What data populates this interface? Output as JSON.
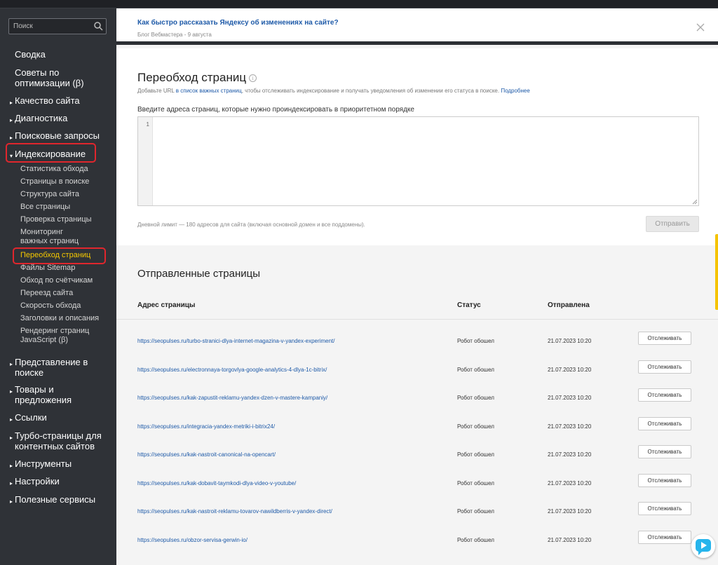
{
  "search": {
    "placeholder": "Поиск"
  },
  "sidebar": {
    "top_items": [
      "Сводка",
      "Советы по оптимизации (β)"
    ],
    "sections": [
      "Качество сайта",
      "Диагностика",
      "Поисковые запросы",
      "Индексирование",
      "Представление в поиске",
      "Товары и предложения",
      "Ссылки",
      "Турбо-страницы для контентных сайтов",
      "Инструменты",
      "Настройки",
      "Полезные сервисы"
    ],
    "indexing_items": [
      "Статистика обхода",
      "Страницы в поиске",
      "Структура сайта",
      "Все страницы",
      "Проверка страницы",
      "Мониторинг важных страниц",
      "Переобход страниц",
      "Файлы Sitemap",
      "Обход по счётчикам",
      "Переезд сайта",
      "Скорость обхода",
      "Заголовки и описания",
      "Рендеринг страниц JavaScript (β)"
    ]
  },
  "notice": {
    "title": "Как быстро рассказать Яндексу об изменениях на сайте?",
    "meta": "Блог Вебмастера - 9 августа"
  },
  "recrawl": {
    "title": "Переобход страниц",
    "desc_prefix": "Добавьте URL ",
    "desc_link": "в список важных страниц",
    "desc_middle": ", чтобы отслеживать индексирование и получать уведомления об изменении его статуса в поиске. ",
    "desc_more": "Подробнее",
    "field_label": "Введите адреса страниц, которые нужно проиндексировать в приоритетном порядке",
    "line_number": "1",
    "limit": "Дневной лимит — 180 адресов для сайта (включая основной домен и все поддомены).",
    "submit_label": "Отправить"
  },
  "sent": {
    "title": "Отправленные страницы",
    "columns": {
      "url": "Адрес страницы",
      "status": "Статус",
      "date": "Отправлена"
    },
    "track_label": "Отслеживать",
    "rows": [
      {
        "url": "https://seopulses.ru/turbo-stranici-dlya-internet-magazina-v-yandex-experiment/",
        "status": "Робот обошел",
        "date": "21.07.2023 10:20"
      },
      {
        "url": "https://seopulses.ru/electronnaya-torgovlya-google-analytics-4-dlya-1c-bitrix/",
        "status": "Робот обошел",
        "date": "21.07.2023 10:20"
      },
      {
        "url": "https://seopulses.ru/kak-zapustit-reklamu-yandex-dzen-v-mastere-kampaniy/",
        "status": "Робот обошел",
        "date": "21.07.2023 10:20"
      },
      {
        "url": "https://seopulses.ru/integracia-yandex-metriki-i-bitrix24/",
        "status": "Робот обошел",
        "date": "21.07.2023 10:20"
      },
      {
        "url": "https://seopulses.ru/kak-nastroit-canonical-na-opencart/",
        "status": "Робот обошел",
        "date": "21.07.2023 10:20"
      },
      {
        "url": "https://seopulses.ru/kak-dobavit-taymkodi-dlya-video-v-youtube/",
        "status": "Робот обошел",
        "date": "21.07.2023 10:20"
      },
      {
        "url": "https://seopulses.ru/kak-nastroit-reklamu-tovarov-nawildberris-v-yandex-direct/",
        "status": "Робот обошел",
        "date": "21.07.2023 10:20"
      },
      {
        "url": "https://seopulses.ru/obzor-servisa-gerwin-io/",
        "status": "Робот обошел",
        "date": "21.07.2023 10:20"
      }
    ]
  },
  "colors": {
    "sidebar_bg": "#2f3237",
    "active": "#f5c800",
    "highlight": "#e0262d",
    "link": "#1e5aa8"
  }
}
